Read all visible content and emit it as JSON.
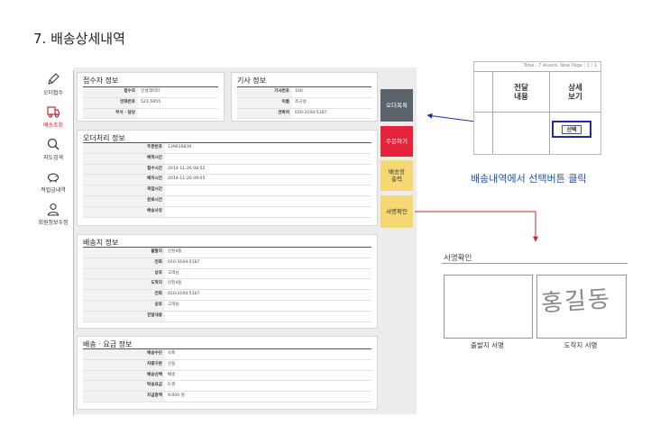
{
  "page_heading": "7. 배송상세내역",
  "nav": [
    {
      "label": "오더접수",
      "icon": "pencil-icon"
    },
    {
      "label": "배송조회",
      "icon": "truck-icon",
      "active": true
    },
    {
      "label": "지도검색",
      "icon": "search-icon"
    },
    {
      "label": "적립금내역",
      "icon": "piggy-bank-icon"
    },
    {
      "label": "회원정보수정",
      "icon": "user-icon"
    }
  ],
  "receiver": {
    "title": "접수자 정보",
    "rows": [
      {
        "label": "접수자",
        "value": "인성데이타"
      },
      {
        "label": "전화번호",
        "value": "521-5955"
      },
      {
        "label": "부서 · 담당",
        "value": ""
      }
    ]
  },
  "driver": {
    "title": "기사 정보",
    "rows": [
      {
        "label": "기사번호",
        "value": "100"
      },
      {
        "label": "이름",
        "value": "조규성"
      },
      {
        "label": "연락처",
        "value": "010-3194-5167"
      }
    ]
  },
  "order": {
    "title": "오더처리 정보",
    "rows": [
      {
        "label": "주문번호",
        "value": "139016839"
      },
      {
        "label": "배착시간",
        "value": ""
      },
      {
        "label": "접수시간",
        "value": "2014-11-26 08:52"
      },
      {
        "label": "배차시간",
        "value": "2014-11-26 09:05"
      },
      {
        "label": "픽업시간",
        "value": ""
      },
      {
        "label": "완료시간",
        "value": ""
      },
      {
        "label": "배송사유",
        "value": ""
      }
    ]
  },
  "delivery": {
    "title": "배송지 정보",
    "rows": [
      {
        "label": "출발지",
        "value": "인천4동"
      },
      {
        "label": "전화",
        "value": "010-3194-5167"
      },
      {
        "label": "상호",
        "value": "고객님"
      },
      {
        "label": "도착지",
        "value": "인천4동"
      },
      {
        "label": "전화",
        "value": "010-3194-5167"
      },
      {
        "label": "상호",
        "value": "고객님"
      },
      {
        "label": "전달내용",
        "value": ""
      }
    ]
  },
  "fee": {
    "title": "배송 · 요금 정보",
    "rows": [
      {
        "label": "배송수단",
        "value": "오토"
      },
      {
        "label": "차량구분",
        "value": "신용"
      },
      {
        "label": "배송선택",
        "value": "배송"
      },
      {
        "label": "탁송요금",
        "value": "0 원"
      },
      {
        "label": "지급총액",
        "value": "9,000 원"
      }
    ]
  },
  "buttons": {
    "order_list": "오더목록",
    "reorder": "주문하기",
    "print_invoice": "배송장\n출력",
    "sign_confirm": "서명확인"
  },
  "inset": {
    "top_text": "Total : 7 Assets, Now Page : 1 / 1",
    "col_delivery": "전달\n내용",
    "col_detail": "상세\n보기",
    "select_button": "선택"
  },
  "caption": "배송내역에서 선택버튼 클릭",
  "signature": {
    "title": "서명확인",
    "origin_label": "출발지 서명",
    "dest_label": "도착지 서명",
    "dest_signature_text": "홍길동"
  },
  "colors": {
    "accent_red": "#e5243b",
    "dark_button": "#5b646b",
    "yellow_button": "#f5d874",
    "highlight_blue": "#1c2f9c"
  }
}
